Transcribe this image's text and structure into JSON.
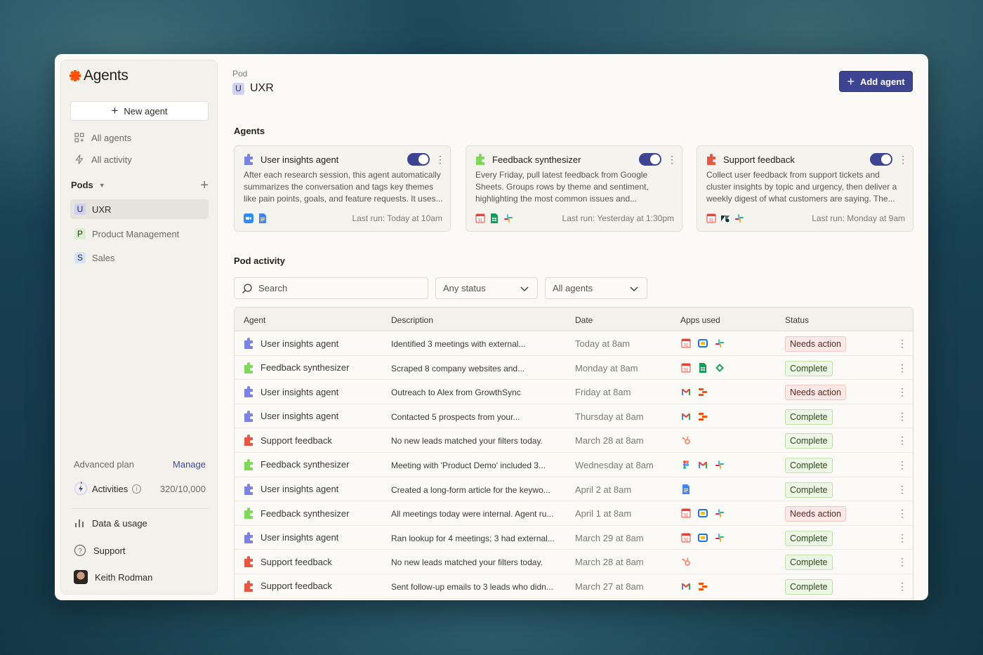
{
  "app": {
    "name": "Agents",
    "new_agent": "New agent"
  },
  "nav": [
    {
      "label": "All agents",
      "icon": "grid-icon"
    },
    {
      "label": "All activity",
      "icon": "bolt-icon"
    }
  ],
  "pods_section": {
    "title": "Pods",
    "items": [
      {
        "letter": "U",
        "label": "UXR",
        "color": "#cfd0f5",
        "active": true
      },
      {
        "letter": "P",
        "label": "Product Management",
        "color": "#d9f0cf",
        "active": false
      },
      {
        "letter": "S",
        "label": "Sales",
        "color": "#d6e3f7",
        "active": false
      }
    ]
  },
  "plan": {
    "label": "Advanced plan",
    "manage": "Manage",
    "activities_label": "Activities",
    "activities_count": "320/10,000",
    "activities_fraction": 0.032
  },
  "bottom": [
    {
      "label": "Data & usage",
      "icon": "bar-chart-icon"
    },
    {
      "label": "Support",
      "icon": "help-circle-icon"
    },
    {
      "label": "Keith Rodman",
      "icon": "avatar"
    }
  ],
  "header": {
    "crumb": "Pod",
    "pod_letter": "U",
    "pod_name": "UXR",
    "add_agent": "Add agent"
  },
  "agents_title": "Agents",
  "agents": [
    {
      "name": "User insights agent",
      "color": "#7b82e6",
      "enabled": true,
      "desc": "After each research session, this agent automatically summarizes the conversation and tags key themes like pain points, goals, and feature requests. It uses...",
      "apps": [
        "zoom-icon",
        "google-docs-icon"
      ],
      "last_run": "Last run: Today at 10am"
    },
    {
      "name": "Feedback synthesizer",
      "color": "#7ed957",
      "enabled": true,
      "desc": "Every Friday, pull latest feedback from Google Sheets. Groups rows by theme and sentiment, highlighting the most common issues and...",
      "apps": [
        "google-calendar-icon",
        "google-sheets-icon",
        "slack-icon"
      ],
      "last_run": "Last run: Yesterday at 1:30pm"
    },
    {
      "name": "Support feedback",
      "color": "#e8573f",
      "enabled": true,
      "desc": "Collect user feedback from support tickets and cluster insights by topic and urgency, then deliver a weekly digest of what customers are saying. The...",
      "apps": [
        "google-calendar-icon",
        "zendesk-icon",
        "slack-icon"
      ],
      "last_run": "Last run: Monday at 9am"
    }
  ],
  "activity_title": "Pod activity",
  "filters": {
    "search_placeholder": "Search",
    "status": "Any status",
    "agents": "All agents"
  },
  "table": {
    "headers": {
      "agent": "Agent",
      "description": "Description",
      "date": "Date",
      "apps": "Apps used",
      "status": "Status"
    },
    "rows": [
      {
        "agent": "User insights agent",
        "color": "#7b82e6",
        "desc": "Identified 3 meetings with external...",
        "date": "Today at 8am",
        "apps": [
          "google-calendar-icon",
          "google-meet-icon",
          "slack-icon"
        ],
        "status": "Needs action"
      },
      {
        "agent": "Feedback synthesizer",
        "color": "#7ed957",
        "desc": "Scraped 8 company websites and...",
        "date": "Monday at 8am",
        "apps": [
          "google-calendar-icon",
          "google-sheets-icon",
          "diamond-icon"
        ],
        "status": "Complete"
      },
      {
        "agent": "User insights agent",
        "color": "#7b82e6",
        "desc": "Outreach to Alex from GrowthSync",
        "date": "Friday at 8am",
        "apps": [
          "gmail-icon",
          "zapier-tables-icon"
        ],
        "status": "Needs action"
      },
      {
        "agent": "User insights agent",
        "color": "#7b82e6",
        "desc": "Contacted 5 prospects from your...",
        "date": "Thursday at 8am",
        "apps": [
          "gmail-icon",
          "zapier-tables-icon"
        ],
        "status": "Complete"
      },
      {
        "agent": "Support feedback",
        "color": "#e8573f",
        "desc": "No new leads matched your filters today.",
        "date": "March 28 at 8am",
        "apps": [
          "hubspot-icon"
        ],
        "status": "Complete"
      },
      {
        "agent": "Feedback synthesizer",
        "color": "#7ed957",
        "desc": "Meeting with 'Product Demo' included 3...",
        "date": "Wednesday at 8am",
        "apps": [
          "figma-icon",
          "gmail-icon",
          "slack-icon"
        ],
        "status": "Complete"
      },
      {
        "agent": "User insights agent",
        "color": "#7b82e6",
        "desc": "Created a long-form article for the keywo...",
        "date": "April 2 at 8am",
        "apps": [
          "google-docs-icon"
        ],
        "status": "Complete"
      },
      {
        "agent": "Feedback synthesizer",
        "color": "#7ed957",
        "desc": "All meetings today were internal. Agent ru...",
        "date": "April 1 at 8am",
        "apps": [
          "google-calendar-icon",
          "google-meet-icon",
          "slack-icon"
        ],
        "status": "Needs action"
      },
      {
        "agent": "User insights agent",
        "color": "#7b82e6",
        "desc": "Ran lookup for 4 meetings; 3 had external...",
        "date": "March 29 at 8am",
        "apps": [
          "google-calendar-icon",
          "google-meet-icon",
          "slack-icon"
        ],
        "status": "Complete"
      },
      {
        "agent": "Support feedback",
        "color": "#e8573f",
        "desc": "No new leads matched your filters today.",
        "date": "March 28 at 8am",
        "apps": [
          "hubspot-icon"
        ],
        "status": "Complete"
      },
      {
        "agent": "Support feedback",
        "color": "#e8573f",
        "desc": "Sent follow-up emails to 3 leads who didn...",
        "date": "March 27 at 8am",
        "apps": [
          "gmail-icon",
          "zapier-tables-icon"
        ],
        "status": "Complete"
      }
    ]
  }
}
